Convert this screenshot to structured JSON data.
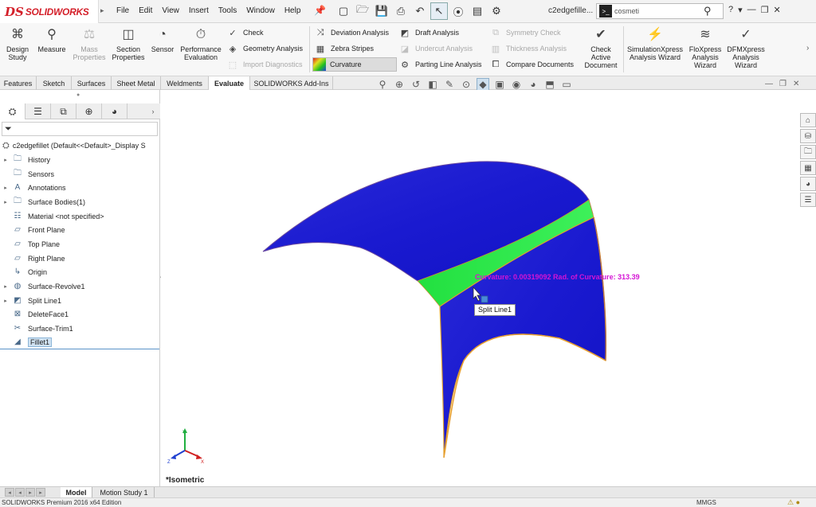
{
  "app": {
    "logo_mark": "DS",
    "logo_text": "SOLIDWORKS",
    "document_name": "c2edgefille..."
  },
  "menu": [
    "File",
    "Edit",
    "View",
    "Insert",
    "Tools",
    "Window",
    "Help"
  ],
  "search": {
    "value": "cosmeti"
  },
  "command_manager": {
    "design_study": "Design Study",
    "measure": "Measure",
    "mass_properties": "Mass Properties",
    "section_properties": "Section Properties",
    "sensor": "Sensor",
    "performance_evaluation": "Performance Evaluation",
    "check": "Check",
    "geometry_analysis": "Geometry Analysis",
    "import_diagnostics": "Import Diagnostics",
    "deviation_analysis": "Deviation Analysis",
    "zebra_stripes": "Zebra Stripes",
    "curvature": "Curvature",
    "draft_analysis": "Draft Analysis",
    "undercut_analysis": "Undercut Analysis",
    "parting_line_analysis": "Parting Line Analysis",
    "symmetry_check": "Symmetry Check",
    "thickness_analysis": "Thickness Analysis",
    "compare_documents": "Compare Documents",
    "check_active_document": "Check Active Document",
    "simulationxpress": "SimulationXpress Analysis Wizard",
    "floxpress": "FloXpress Analysis Wizard",
    "dfmxpress": "DFMXpress Analysis Wizard"
  },
  "tabs": [
    "Features",
    "Sketch",
    "Surfaces",
    "Sheet Metal",
    "Weldments",
    "Evaluate",
    "SOLIDWORKS Add-Ins"
  ],
  "tree": {
    "root": "c2edgefillet (Default<<Default>_Display S",
    "items": [
      {
        "label": "History"
      },
      {
        "label": "Sensors"
      },
      {
        "label": "Annotations"
      },
      {
        "label": "Surface Bodies(1)"
      },
      {
        "label": "Material <not specified>"
      },
      {
        "label": "Front Plane"
      },
      {
        "label": "Top Plane"
      },
      {
        "label": "Right Plane"
      },
      {
        "label": "Origin"
      },
      {
        "label": "Surface-Revolve1"
      },
      {
        "label": "Split Line1"
      },
      {
        "label": "DeleteFace1"
      },
      {
        "label": "Surface-Trim1"
      },
      {
        "label": "Fillet1"
      }
    ]
  },
  "viewport": {
    "curvature_readout": "Curvature: 0.00319092  Rad. of Curvature: 313.39",
    "tooltip": "Split Line1",
    "view_orientation": "*Isometric",
    "surface_colors": {
      "body": "#1f1fd0",
      "band": "#2ee84a",
      "edge": "#e8a030"
    }
  },
  "bottom_tabs": [
    "Model",
    "Motion Study 1"
  ],
  "status": {
    "edition": "SOLIDWORKS Premium 2016 x64 Edition",
    "units": "MMGS"
  }
}
